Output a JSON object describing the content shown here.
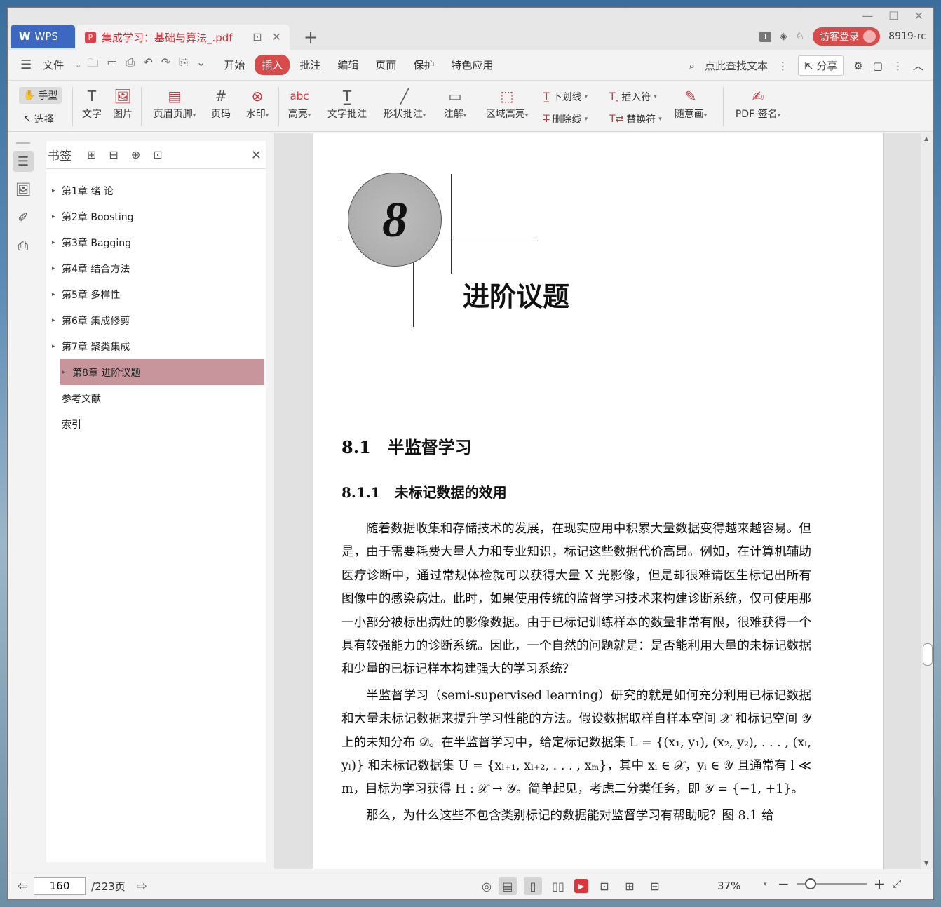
{
  "titlebar": {
    "app_tab": "WPS",
    "doc_tab": "集成学习：基础与算法_.pdf",
    "page_count_badge": "1",
    "login": "访客登录",
    "user_id": "8919-rc"
  },
  "menubar": {
    "file": "文件",
    "items": [
      "开始",
      "插入",
      "批注",
      "编辑",
      "页面",
      "保护",
      "特色应用"
    ],
    "active": "插入",
    "search": "点此查找文本",
    "share": "分享"
  },
  "ribbon": {
    "hand": "手型",
    "select": "选择",
    "text": "文字",
    "image": "图片",
    "header_footer": "页眉页脚",
    "page_num": "页码",
    "watermark": "水印",
    "highlight": "高亮",
    "text_annot": "文字批注",
    "shape_annot": "形状批注",
    "note": "注解",
    "area_highlight": "区域高亮",
    "underline": "下划线",
    "strikethrough": "删除线",
    "insert_mark": "插入符",
    "replace_mark": "替换符",
    "freehand": "随意画",
    "pdf_sign": "PDF 签名"
  },
  "bookmarks": {
    "title": "书签",
    "items": [
      {
        "label": "第1章 绪 论",
        "expandable": true
      },
      {
        "label": "第2章 Boosting",
        "expandable": true
      },
      {
        "label": "第3章 Bagging",
        "expandable": true
      },
      {
        "label": "第4章 结合方法",
        "expandable": true
      },
      {
        "label": "第5章 多样性",
        "expandable": true
      },
      {
        "label": "第6章 集成修剪",
        "expandable": true
      },
      {
        "label": "第7章 聚类集成",
        "expandable": true
      },
      {
        "label": "第8章 进阶议题",
        "expandable": true,
        "selected": true
      },
      {
        "label": "参考文献",
        "expandable": false
      },
      {
        "label": "索引",
        "expandable": false
      }
    ]
  },
  "document": {
    "chapter_number": "8",
    "chapter_title": "进阶议题",
    "section": "8.1　半监督学习",
    "subsection": "8.1.1　未标记数据的效用",
    "para1": "随着数据收集和存储技术的发展，在现实应用中积累大量数据变得越来越容易。但是，由于需要耗费大量人力和专业知识，标记这些数据代价高昂。例如，在计算机辅助医疗诊断中，通过常规体检就可以获得大量 X 光影像，但是却很难请医生标记出所有图像中的感染病灶。此时，如果使用传统的监督学习技术来构建诊断系统，仅可使用那一小部分被标出病灶的影像数据。由于已标记训练样本的数量非常有限，很难获得一个具有较强能力的诊断系统。因此，一个自然的问题就是：是否能利用大量的未标记数据和少量的已标记样本构建强大的学习系统？",
    "para2": "半监督学习（semi-supervised learning）研究的就是如何充分利用已标记数据和大量未标记数据来提升学习性能的方法。假设数据取样自样本空间 𝒳 和标记空间 𝒴 上的未知分布 𝒟。在半监督学习中，给定标记数据集 L = {(x₁, y₁), (x₂, y₂), . . . , (xₗ, yₗ)} 和未标记数据集 U = {xₗ₊₁, xₗ₊₂, . . . , xₘ}，其中 xᵢ ∈ 𝒳，yᵢ ∈ 𝒴 且通常有 l ≪ m，目标为学习获得 H : 𝒳 → 𝒴。简单起见，考虑二分类任务，即 𝒴 = {−1, +1}。",
    "para3": "那么，为什么这些不包含类别标记的数据能对监督学习有帮助呢？图 8.1 给"
  },
  "statusbar": {
    "current_page": "160",
    "total_pages": "/223页",
    "zoom": "37%"
  }
}
